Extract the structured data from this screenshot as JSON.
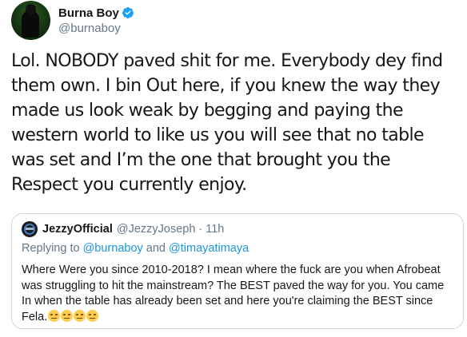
{
  "author": {
    "display_name": "Burna Boy",
    "handle": "@burnaboy",
    "avatar_icon": "profile-photo"
  },
  "tweet": {
    "text": "Lol. NOBODY paved shit for me. Everybody dey find them own. I bin Out here, if you knew the way they made us look weak by begging and paying the western world to like us you will see that no table was set and I’m the one that brought you the Respect you currently enjoy."
  },
  "quoted": {
    "display_name": "JezzyOfficial",
    "handle": "@JezzyJoseph",
    "separator": "·",
    "time": "11h",
    "replying_prefix": "Replying to",
    "reply_to_1": "@burnaboy",
    "reply_joiner": "and",
    "reply_to_2": "@timayatimaya",
    "text": "Where Were you since 2010-2018? I mean where the fuck are you when Afrobeat was struggling to hit the mainstream? The BEST paved the way for you. You came In when  the table has already been set and here you're claiming the  BEST since Fela."
  },
  "colors": {
    "link": "#1b95e0",
    "muted": "#657786",
    "verified": "#1da1f2",
    "border": "#ccd6dd"
  }
}
